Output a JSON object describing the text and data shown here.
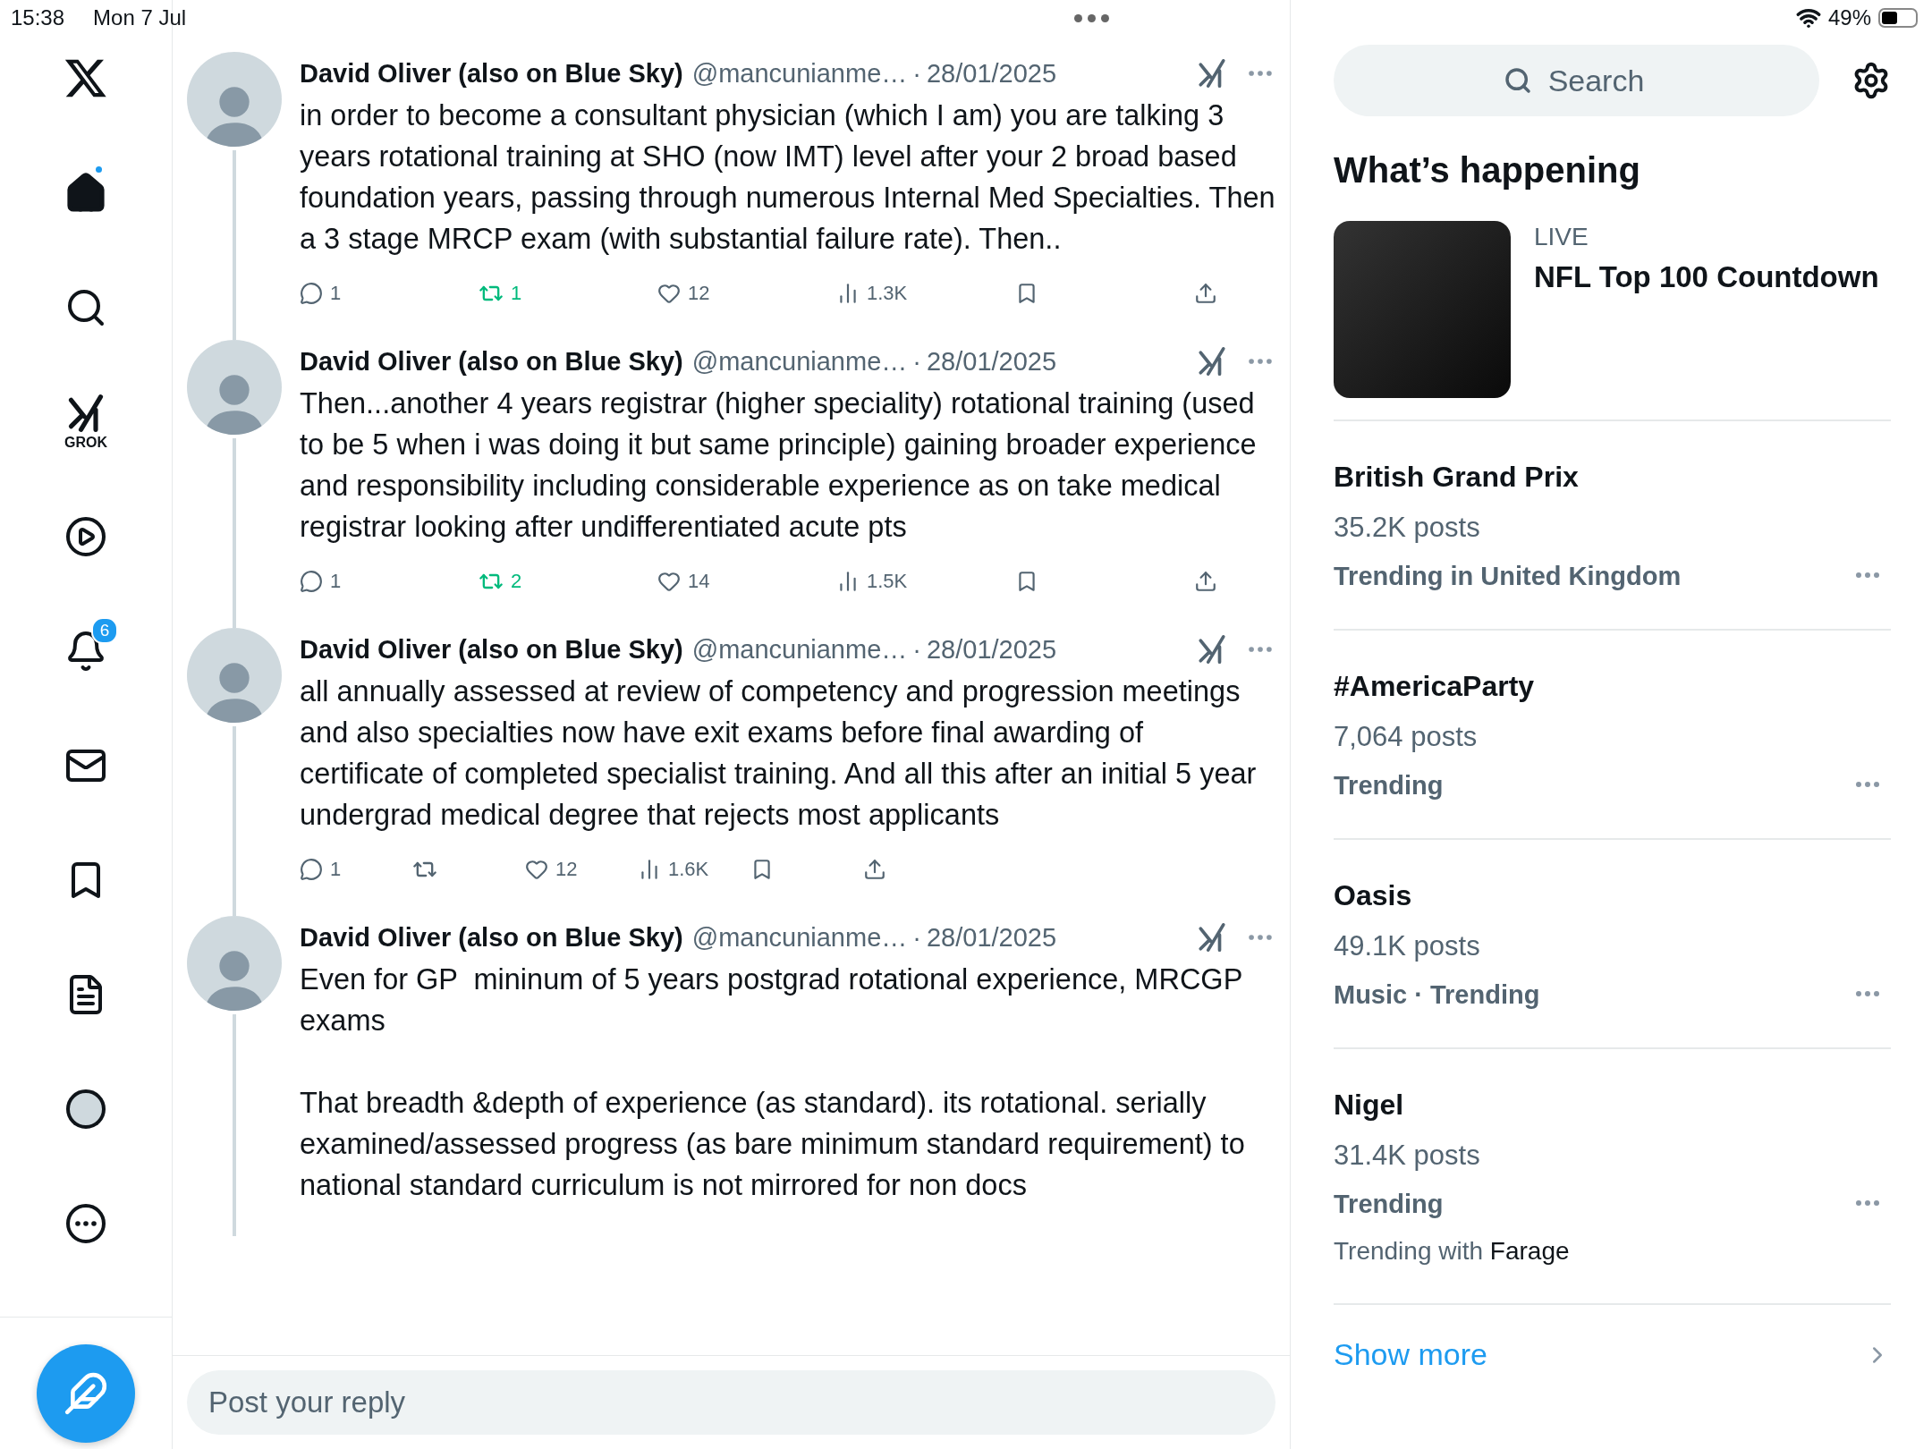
{
  "status_bar": {
    "time": "15:38",
    "date": "Mon 7 Jul",
    "battery": "49%"
  },
  "nav": {
    "items": [
      {
        "kind": "home",
        "selected": true,
        "unread": true
      },
      {
        "kind": "search",
        "selected": false
      },
      {
        "kind": "grok",
        "selected": false,
        "label": "GROK"
      },
      {
        "kind": "video",
        "selected": false
      },
      {
        "kind": "notifications",
        "selected": false,
        "badge": "6"
      },
      {
        "kind": "messages",
        "selected": false
      },
      {
        "kind": "bookmarks",
        "selected": false
      },
      {
        "kind": "lists",
        "selected": false
      },
      {
        "kind": "profile",
        "selected": false
      },
      {
        "kind": "more",
        "selected": false
      }
    ]
  },
  "tweets": [
    {
      "name": "David Oliver (also on Blue Sky)",
      "handle": "@mancunianme…",
      "separator": "·",
      "date": "28/01/2025",
      "text": "in order to become a consultant physician (which I am) you are talking 3 years rotational training at SHO (now IMT) level after your 2 broad based foundation years, passing through numerous Internal Med Specialties. Then a 3 stage MRCP exam (with substantial failure rate). Then..",
      "actions": {
        "replies": "1",
        "reposts": "1",
        "reposted": true,
        "likes": "12",
        "views": "1.3K"
      }
    },
    {
      "name": "David Oliver (also on Blue Sky)",
      "handle": "@mancunianme…",
      "separator": "·",
      "date": "28/01/2025",
      "text": "Then...another 4 years registrar (higher speciality) rotational training (used to be 5 when i was doing it but same principle) gaining broader experience and responsibility including considerable experience as on take medical registrar looking after undifferentiated acute pts",
      "actions": {
        "replies": "1",
        "reposts": "2",
        "reposted": true,
        "likes": "14",
        "views": "1.5K"
      }
    },
    {
      "name": "David Oliver (also on Blue Sky)",
      "handle": "@mancunianme…",
      "separator": "·",
      "date": "28/01/2025",
      "text": "all annually assessed at review of competency and progression meetings and also specialties now have exit exams before final awarding of certificate of completed specialist training. And all this after an initial 5 year undergrad medical degree that rejects most applicants",
      "actions": {
        "replies": "1",
        "reposted": false,
        "likes": "12",
        "views": "1.6K"
      }
    },
    {
      "name": "David Oliver (also on Blue Sky)",
      "handle": "@mancunianme…",
      "separator": "·",
      "date": "28/01/2025",
      "text": "Even for GP  mininum of 5 years postgrad rotational experience, MRCGP exams\n\nThat breadth &depth of experience (as standard). its rotational. serially examined/assessed progress (as bare minimum standard requirement) to national standard curriculum is not mirrored for non docs"
    }
  ],
  "reply": {
    "placeholder": "Post your reply"
  },
  "sidebar": {
    "search": {
      "placeholder": "Search"
    },
    "title": "What’s happening",
    "live": {
      "tag": "LIVE",
      "title": "NFL Top 100 Countdown"
    },
    "trends": [
      {
        "name": "British Grand Prix",
        "posts": "35.2K posts",
        "context": "Trending in United Kingdom"
      },
      {
        "name": "#AmericaParty",
        "posts": "7,064 posts",
        "context": "Trending"
      },
      {
        "name": "Oasis",
        "posts": "49.1K posts",
        "context": "Music · Trending"
      },
      {
        "name": "Nigel",
        "posts": "31.4K posts",
        "context": "Trending",
        "related": "Trending with **Farage**"
      }
    ],
    "show_more": "Show more"
  }
}
